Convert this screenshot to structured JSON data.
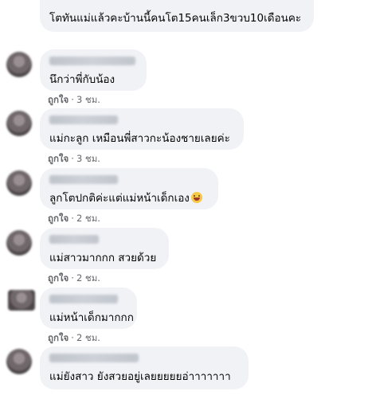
{
  "comments": [
    {
      "text": "โตทันแม่แล้วคะบ้านนี้คนโต15คนเล็ก3ขวบ10เดือนคะ",
      "like": "",
      "time": ""
    },
    {
      "text": "นึกว่าพี่กับน้อง",
      "like": "ถูกใจ",
      "time": "3 ชม."
    },
    {
      "text": "แม่กะลูก เหมือนพี่สาวกะน้องชายเลยค่ะ",
      "like": "ถูกใจ",
      "time": "3 ชม."
    },
    {
      "text": "ลูกโตปกติค่ะแต่แม่หน้าเด็กเอง",
      "like": "ถูกใจ",
      "time": "2 ชม.",
      "emoji": "grinning-squinting-face-icon"
    },
    {
      "text": "แม่สาวมากกก สวยด้วย",
      "like": "ถูกใจ",
      "time": "2 ชม."
    },
    {
      "text": "แม่หน้าเด็กมากกก",
      "like": "ถูกใจ",
      "time": "2 ชม."
    },
    {
      "text": "แม่ยังสาว ยังสวยอยู่เลยยยยยอ่าาาาาาา",
      "like": "",
      "time": ""
    }
  ],
  "separator": "·",
  "colors": {
    "bubble": "#f0f2f5",
    "meta_text": "#65676b",
    "text": "#050505"
  }
}
